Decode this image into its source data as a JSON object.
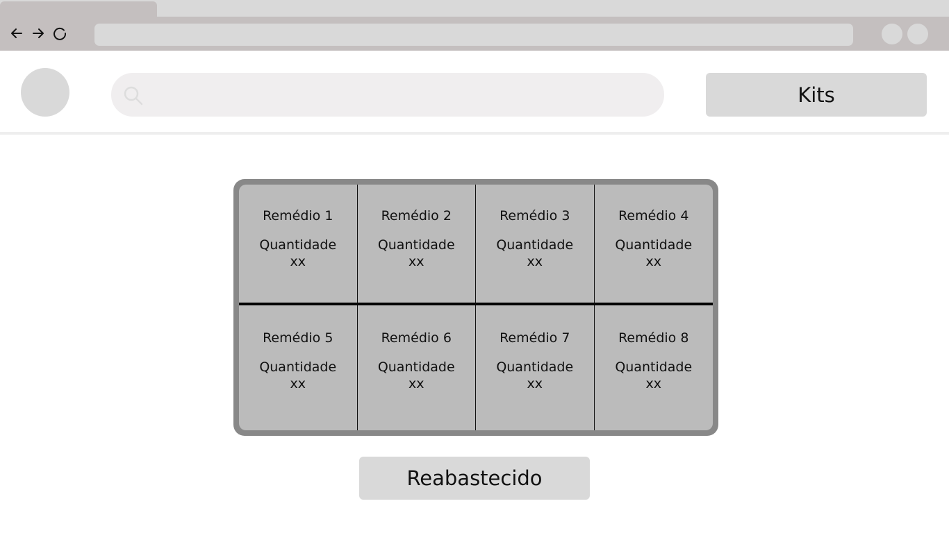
{
  "header": {
    "search_placeholder": "",
    "kits_label": "Kits"
  },
  "cabinet": {
    "slots": [
      {
        "name": "Remédio 1",
        "qty_label": "Quantidade",
        "qty": "xx"
      },
      {
        "name": "Remédio 2",
        "qty_label": "Quantidade",
        "qty": "xx"
      },
      {
        "name": "Remédio 3",
        "qty_label": "Quantidade",
        "qty": "xx"
      },
      {
        "name": "Remédio 4",
        "qty_label": "Quantidade",
        "qty": "xx"
      },
      {
        "name": "Remédio 5",
        "qty_label": "Quantidade",
        "qty": "xx"
      },
      {
        "name": "Remédio 6",
        "qty_label": "Quantidade",
        "qty": "xx"
      },
      {
        "name": "Remédio 7",
        "qty_label": "Quantidade",
        "qty": "xx"
      },
      {
        "name": "Remédio 8",
        "qty_label": "Quantidade",
        "qty": "xx"
      }
    ]
  },
  "actions": {
    "restock_label": "Reabastecido"
  },
  "icons": {
    "back": "back-arrow-icon",
    "forward": "forward-arrow-icon",
    "reload": "reload-icon",
    "search": "search-icon"
  },
  "colors": {
    "browser_chrome": "#c4bfbf",
    "button_bg": "#d9d9d9",
    "cabinet_frame": "#888888",
    "cabinet_fill": "#bbbbbb"
  }
}
